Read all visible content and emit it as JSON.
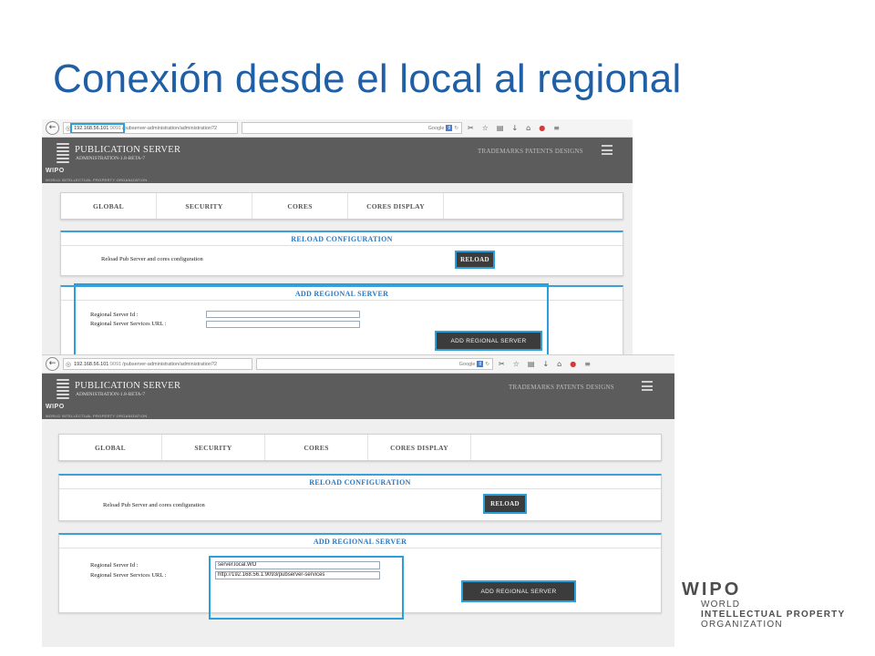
{
  "slide": {
    "title": "Conexión desde el local al regional"
  },
  "colors": {
    "title": "#1f5fa6",
    "header_bg": "#5c5c5c",
    "highlight": "#2b9fdc",
    "panel_title": "#2a78c0",
    "button_bg": "#3c3c3c"
  },
  "top_window": {
    "browser": {
      "url_host": "192.168.56.101",
      "url_port": ":9091",
      "url_path": "/pubserver-administration/administration?2",
      "search_engine": "Google",
      "icons": [
        "back-icon",
        "globe-icon",
        "star-icon",
        "clipboard-icon",
        "download-icon",
        "home-icon",
        "adblock-icon",
        "menu-icon"
      ]
    },
    "header": {
      "logo_text": "WIPO",
      "tagline": "WORLD INTELLECTUAL PROPERTY ORGANIZATION",
      "app_title": "PUBLICATION SERVER",
      "version": "ADMINISTRATION-1.8-BETA-7",
      "links": "TRADEMARKS PATENTS DESIGNS"
    },
    "tabs": [
      "GLOBAL",
      "SECURITY",
      "CORES",
      "CORES DISPLAY"
    ],
    "reload": {
      "title": "RELOAD CONFIGURATION",
      "description": "Reload Pub Server and cores configuration",
      "button": "RELOAD"
    },
    "regional": {
      "title": "ADD REGIONAL SERVER",
      "id_label": "Regional Server Id :",
      "url_label": "Regional Server Services URL :",
      "id_value": "",
      "url_value": "",
      "button": "ADD REGIONAL SERVER"
    }
  },
  "bottom_window": {
    "browser": {
      "url_host": "192.168.56.101",
      "url_port": ":9091",
      "url_path": "/pubserver-administration/administration?2",
      "search_engine": "Google",
      "icons": [
        "back-icon",
        "globe-icon",
        "star-icon",
        "clipboard-icon",
        "download-icon",
        "home-icon",
        "adblock-icon",
        "menu-icon"
      ]
    },
    "header": {
      "logo_text": "WIPO",
      "tagline": "WORLD INTELLECTUAL PROPERTY ORGANIZATION",
      "app_title": "PUBLICATION SERVER",
      "version": "ADMINISTRATION-1.8-BETA-7",
      "links": "TRADEMARKS PATENTS DESIGNS"
    },
    "tabs": [
      "GLOBAL",
      "SECURITY",
      "CORES",
      "CORES DISPLAY"
    ],
    "reload": {
      "title": "RELOAD CONFIGURATION",
      "description": "Reload Pub Server and cores configuration",
      "button": "RELOAD"
    },
    "regional": {
      "title": "ADD REGIONAL SERVER",
      "id_label": "Regional Server Id :",
      "url_label": "Regional Server Services URL :",
      "id_value": "server.local.WO",
      "url_value": "http://192.168.56.1:9093/pubserver-services",
      "button": "ADD REGIONAL SERVER"
    }
  },
  "brand": {
    "wipo": "WIPO",
    "line1": "WORLD",
    "line2": "INTELLECTUAL PROPERTY",
    "line3": "ORGANIZATION"
  }
}
